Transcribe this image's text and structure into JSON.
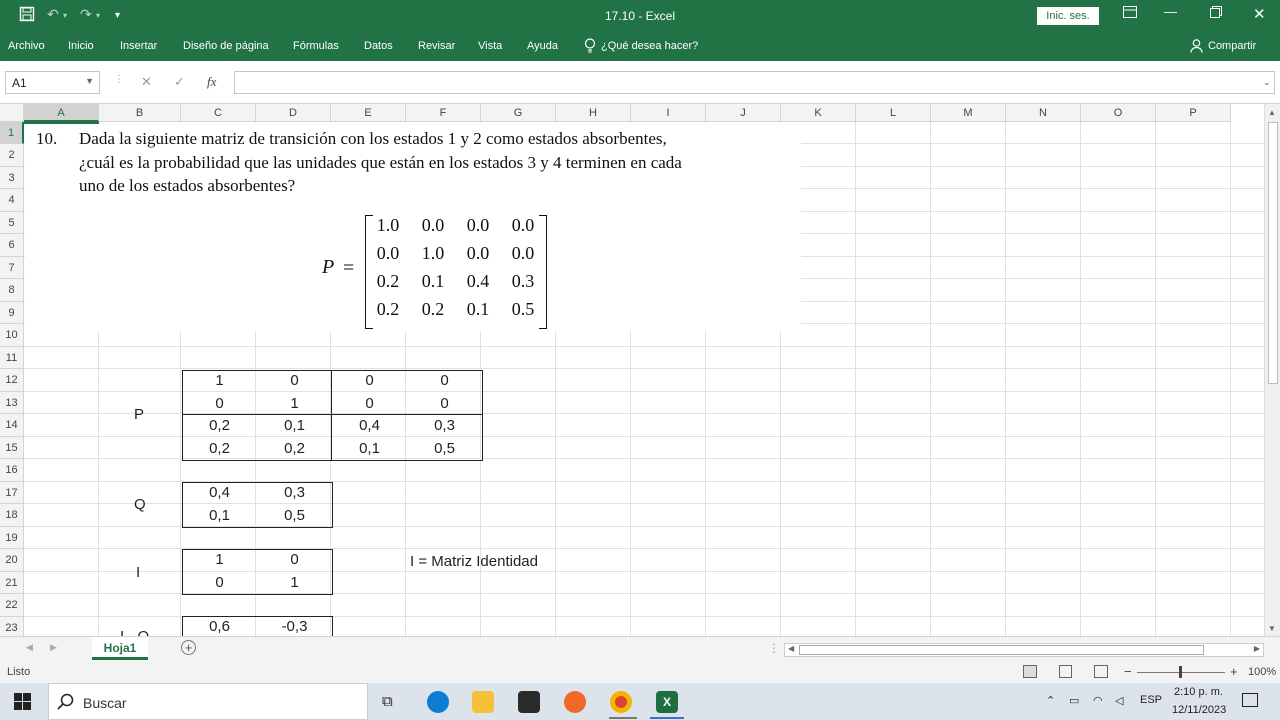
{
  "window": {
    "title": "17.10  -  Excel",
    "signin_label": "Inic. ses.",
    "qat": {
      "save_icon": "save-icon",
      "undo_icon": "undo-icon",
      "redo_icon": "redo-icon",
      "customize_icon": "chevron-down-icon"
    }
  },
  "ribbon": {
    "tabs": [
      "Archivo",
      "Inicio",
      "Insertar",
      "Diseño de página",
      "Fórmulas",
      "Datos",
      "Revisar",
      "Vista",
      "Ayuda"
    ],
    "tell_me": "¿Qué desea hacer?",
    "share": "Compartir"
  },
  "formula_bar": {
    "name_box": "A1",
    "cancel_symbol": "✕",
    "enter_symbol": "✓",
    "fx_symbol": "fx",
    "formula": ""
  },
  "grid": {
    "columns": [
      "A",
      "B",
      "C",
      "D",
      "E",
      "F",
      "G",
      "H",
      "I",
      "J",
      "K",
      "L",
      "M",
      "N",
      "O",
      "P"
    ],
    "rows": [
      "1",
      "2",
      "3",
      "4",
      "5",
      "6",
      "7",
      "8",
      "9",
      "10",
      "11",
      "12",
      "13",
      "14",
      "15",
      "16",
      "17",
      "18",
      "19",
      "20",
      "21",
      "22",
      "23"
    ]
  },
  "problem": {
    "number": "10.",
    "line1": "Dada la siguiente matriz de transición con los estados 1 y 2 como estados absorbentes,",
    "line2": "¿cuál es la probabilidad que las unidades que están en los estados 3 y 4 terminen en cada",
    "line3": "uno de los estados absorbentes?",
    "matrix_label": "P",
    "matrix_eq": "=",
    "matrix": [
      [
        "1.0",
        "0.0",
        "0.0",
        "0.0"
      ],
      [
        "0.0",
        "1.0",
        "0.0",
        "0.0"
      ],
      [
        "0.2",
        "0.1",
        "0.4",
        "0.3"
      ],
      [
        "0.2",
        "0.2",
        "0.1",
        "0.5"
      ]
    ]
  },
  "cells": {
    "P_label": "P",
    "P": [
      [
        "1",
        "0",
        "0",
        "0"
      ],
      [
        "0",
        "1",
        "0",
        "0"
      ],
      [
        "0,2",
        "0,1",
        "0,4",
        "0,3"
      ],
      [
        "0,2",
        "0,2",
        "0,1",
        "0,5"
      ]
    ],
    "Q_label": "Q",
    "Q": [
      [
        "0,4",
        "0,3"
      ],
      [
        "0,1",
        "0,5"
      ]
    ],
    "I_label": "I",
    "I": [
      [
        "1",
        "0"
      ],
      [
        "0",
        "1"
      ]
    ],
    "I_note": "I = Matriz Identidad",
    "IQ_label": "I - Q",
    "IQ_row": [
      "0,6",
      "-0,3"
    ]
  },
  "sheets": {
    "active": "Hoja1",
    "add_symbol": "+"
  },
  "status": {
    "ready": "Listo",
    "zoom": "100%",
    "zoom_minus": "−",
    "zoom_plus": "+"
  },
  "taskbar": {
    "search": "Buscar",
    "lang": "ESP",
    "time": "2:10 p. m.",
    "date": "12/11/2023"
  }
}
